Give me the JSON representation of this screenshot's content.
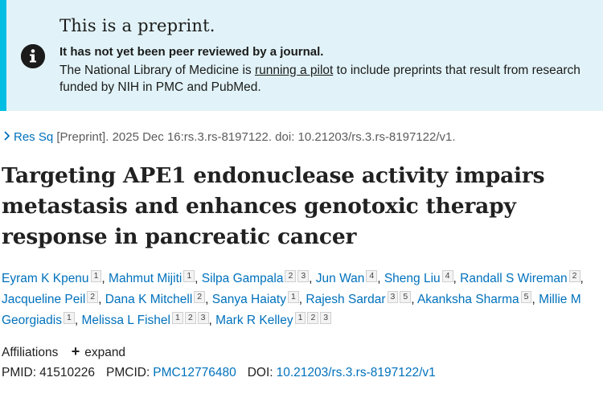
{
  "banner": {
    "title": "This is a preprint.",
    "strong": "It has not yet been peer reviewed by a journal.",
    "text_before": "The National Library of Medicine is ",
    "link": "running a pilot",
    "text_after": " to include preprints that result from research funded by NIH in PMC and PubMed.",
    "icon": "info-icon"
  },
  "citation": {
    "journal": "Res Sq",
    "rest": " [Preprint]. 2025 Dec 16:rs.3.rs-8197122. doi: 10.21203/rs.3.rs-8197122/v1."
  },
  "title": "Targeting APE1 endonuclease activity impairs metastasis and enhances genotoxic therapy response in pancreatic cancer",
  "authors": [
    {
      "name": "Eyram K Kpenu",
      "affs": [
        "1"
      ]
    },
    {
      "name": "Mahmut Mijiti",
      "affs": [
        "1"
      ]
    },
    {
      "name": "Silpa Gampala",
      "affs": [
        "2",
        "3"
      ]
    },
    {
      "name": "Jun Wan",
      "affs": [
        "4"
      ]
    },
    {
      "name": "Sheng Liu",
      "affs": [
        "4"
      ]
    },
    {
      "name": "Randall S Wireman",
      "affs": [
        "2"
      ]
    },
    {
      "name": "Jacqueline Peil",
      "affs": [
        "2"
      ]
    },
    {
      "name": "Dana K Mitchell",
      "affs": [
        "2"
      ]
    },
    {
      "name": "Sanya Haiaty",
      "affs": [
        "1"
      ]
    },
    {
      "name": "Rajesh Sardar",
      "affs": [
        "3",
        "5"
      ]
    },
    {
      "name": "Akanksha Sharma",
      "affs": [
        "5"
      ]
    },
    {
      "name": "Millie M Georgiadis",
      "affs": [
        "1"
      ]
    },
    {
      "name": "Melissa L Fishel",
      "affs": [
        "1",
        "2",
        "3"
      ]
    },
    {
      "name": "Mark R Kelley",
      "affs": [
        "1",
        "2",
        "3"
      ]
    }
  ],
  "affiliations": {
    "label": "Affiliations",
    "expand_label": "expand"
  },
  "ids": {
    "pmid_label": "PMID:",
    "pmid": "41510226",
    "pmcid_label": "PMCID:",
    "pmcid": "PMC12776480",
    "doi_label": "DOI:",
    "doi": "10.21203/rs.3.rs-8197122/v1"
  },
  "colors": {
    "banner_bg": "#e1f3f8",
    "banner_border": "#00bde3",
    "link": "#0071bc"
  }
}
